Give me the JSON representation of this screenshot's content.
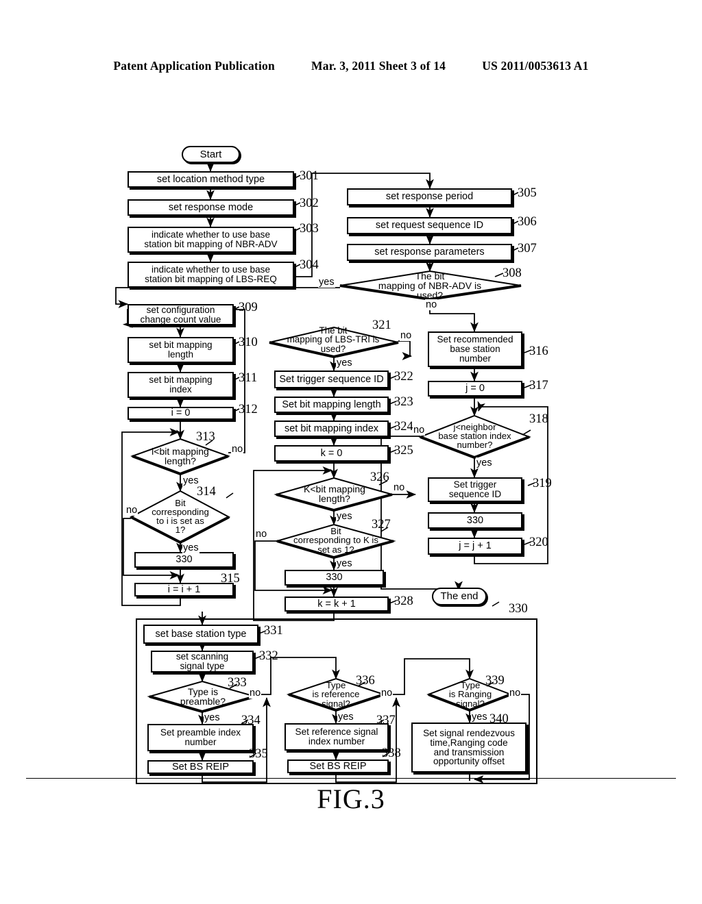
{
  "header": {
    "publication": "Patent Application Publication",
    "date_sheet": "Mar. 3, 2011  Sheet 3 of 14",
    "patent_number": "US 2011/0053613 A1"
  },
  "figure": {
    "caption": "FIG.3"
  },
  "flowchart": {
    "terminals": [
      {
        "id": "start",
        "label": "Start"
      },
      {
        "id": "end",
        "label": "The end"
      }
    ],
    "processes": [
      {
        "ref": "301",
        "label": "set location method type"
      },
      {
        "ref": "302",
        "label": "set response mode"
      },
      {
        "ref": "303",
        "label": "indicate whether to use base\nstation bit mapping of NBR-ADV"
      },
      {
        "ref": "304",
        "label": "indicate whether to use base\nstation bit mapping of LBS-REQ"
      },
      {
        "ref": "305",
        "label": "set response period"
      },
      {
        "ref": "306",
        "label": "set request sequence ID"
      },
      {
        "ref": "307",
        "label": "set response parameters"
      },
      {
        "ref": "309",
        "label": "set configuration\nchange count value"
      },
      {
        "ref": "310",
        "label": "set bit mapping\nlength"
      },
      {
        "ref": "311",
        "label": "set bit mapping\nindex"
      },
      {
        "ref": "312",
        "label": "i = 0"
      },
      {
        "ref": "315",
        "label": "i = i + 1"
      },
      {
        "ref": "316",
        "label": "Set recommended\nbase station\nnumber"
      },
      {
        "ref": "317",
        "label": "j = 0"
      },
      {
        "ref": "319",
        "label": "Set trigger\nsequence ID"
      },
      {
        "ref": "320",
        "label": "j = j + 1"
      },
      {
        "ref": "322",
        "label": "Set trigger sequence ID"
      },
      {
        "ref": "323",
        "label": "Set bit mapping length"
      },
      {
        "ref": "324",
        "label": "set bit mapping index"
      },
      {
        "ref": "325",
        "label": "k = 0"
      },
      {
        "ref": "328",
        "label": "k = k + 1"
      },
      {
        "ref": "331",
        "label": "set base station type"
      },
      {
        "ref": "332",
        "label": "set scanning\nsignal type"
      },
      {
        "ref": "334",
        "label": "Set preamble index\nnumber"
      },
      {
        "ref": "335",
        "label": "Set BS REIP"
      },
      {
        "ref": "337",
        "label": "Set reference signal\nindex number"
      },
      {
        "ref": "338",
        "label": "Set BS REIP"
      },
      {
        "ref": "340",
        "label": "Set signal rendezvous\ntime,Ranging code\nand transmission\nopportunity offset"
      }
    ],
    "subroutine_calls": [
      {
        "id": "call-a",
        "label": "330"
      },
      {
        "id": "call-b",
        "label": "330"
      },
      {
        "id": "call-c",
        "label": "330"
      }
    ],
    "decisions": [
      {
        "ref": "308",
        "label": "The bit\nmapping of NBR-ADV is\nused?",
        "yes": "yes",
        "no": "no"
      },
      {
        "ref": "313",
        "label": "i<bit mapping\nlength?",
        "yes": "yes",
        "no": "no"
      },
      {
        "ref": "314",
        "label": "Bit\ncorresponding\nto i is set as\n1?",
        "yes": "yes",
        "no": "no"
      },
      {
        "ref": "318",
        "label": "j<neighbor\nbase station index\nnumber?",
        "yes": "yes",
        "no": "no"
      },
      {
        "ref": "321",
        "label": "The bit\nmapping of LBS-TRI is\nused?",
        "yes": "yes",
        "no": "no"
      },
      {
        "ref": "326",
        "label": "K<bit mapping\nlength?",
        "yes": "yes",
        "no": "no"
      },
      {
        "ref": "327",
        "label": "Bit\ncorresponding to K is\nset as 1?",
        "yes": "yes",
        "no": "no"
      },
      {
        "ref": "333",
        "label": "Type is\npreamble?",
        "yes": "yes",
        "no": "no"
      },
      {
        "ref": "336",
        "label": "Type\nis reference\nsignal?",
        "yes": "yes",
        "no": "no"
      },
      {
        "ref": "339",
        "label": "Type\nis Ranging\nsignal?",
        "yes": "yes",
        "no": "no"
      }
    ],
    "group_ref": "330",
    "colors": {
      "line": "#000000",
      "fill": "#ffffff",
      "shadow": "#000000"
    }
  }
}
